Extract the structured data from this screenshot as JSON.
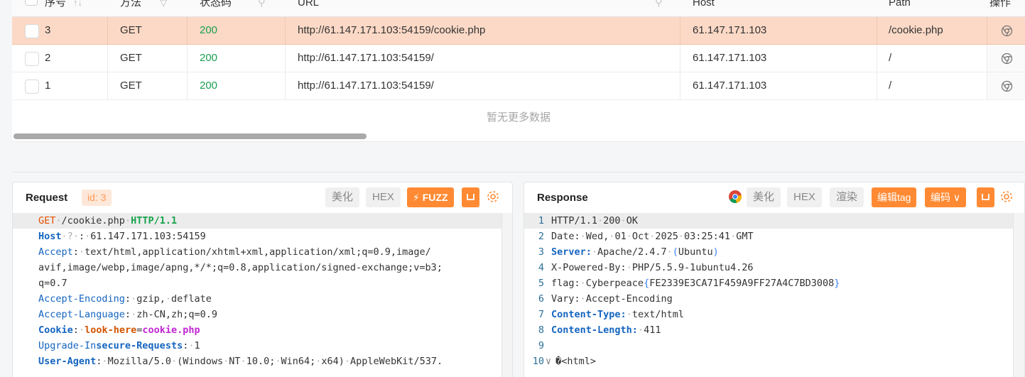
{
  "table": {
    "headers": {
      "seq": "序号",
      "method": "方法",
      "status": "状态码",
      "url": "URL",
      "host": "Host",
      "path": "Path",
      "ops": "操作"
    },
    "rows": [
      {
        "seq": "3",
        "method": "GET",
        "status": "200",
        "url": "http://61.147.171.103:54159/cookie.php",
        "host": "61.147.171.103",
        "path": "/cookie.php",
        "selected": true
      },
      {
        "seq": "2",
        "method": "GET",
        "status": "200",
        "url": "http://61.147.171.103:54159/",
        "host": "61.147.171.103",
        "path": "/",
        "selected": false
      },
      {
        "seq": "1",
        "method": "GET",
        "status": "200",
        "url": "http://61.147.171.103:54159/",
        "host": "61.147.171.103",
        "path": "/",
        "selected": false
      }
    ],
    "empty_text": "暂无更多数据"
  },
  "request": {
    "title": "Request",
    "id_label": "id: 3",
    "buttons": {
      "beautify": "美化",
      "hex": "HEX",
      "fuzz": "FUZZ"
    },
    "lines": [
      "GET /cookie.php HTTP/1.1",
      "Host ? : 61.147.171.103:54159",
      "Accept: text/html,application/xhtml+xml,application/xml;q=0.9,image/",
      "avif,image/webp,image/apng,*/*;q=0.8,application/signed-exchange;v=b3;",
      "q=0.7",
      "Accept-Encoding: gzip, deflate",
      "Accept-Language: zh-CN,zh;q=0.9",
      "Cookie: look-here=cookie.php",
      "Upgrade-Insecure-Requests: 1",
      "User-Agent: Mozilla/5.0 (Windows NT 10.0; Win64; x64) AppleWebKit/537."
    ]
  },
  "response": {
    "title": "Response",
    "buttons": {
      "beautify": "美化",
      "hex": "HEX",
      "render": "渲染",
      "edit_tag": "编辑tag",
      "encoding": "编码"
    },
    "lines": [
      {
        "n": "1",
        "text": "HTTP/1.1 200 OK"
      },
      {
        "n": "2",
        "text": "Date: Wed, 01 Oct 2025 03:25:41 GMT"
      },
      {
        "n": "3",
        "text": "Server: Apache/2.4.7 (Ubuntu)"
      },
      {
        "n": "4",
        "text": "X-Powered-By: PHP/5.5.9-1ubuntu4.26"
      },
      {
        "n": "5",
        "text": "flag: Cyberpeace{FE2339E3CA71F459A9FF27A4C7BD3008}"
      },
      {
        "n": "6",
        "text": "Vary: Accept-Encoding"
      },
      {
        "n": "7",
        "text": "Content-Type: text/html"
      },
      {
        "n": "8",
        "text": "Content-Length: 411"
      },
      {
        "n": "9",
        "text": ""
      },
      {
        "n": "10",
        "text": "�<html>"
      }
    ]
  },
  "colors": {
    "accent": "#ff8a33",
    "selected_row": "#fcd9c6",
    "status_ok": "#1aa053"
  }
}
